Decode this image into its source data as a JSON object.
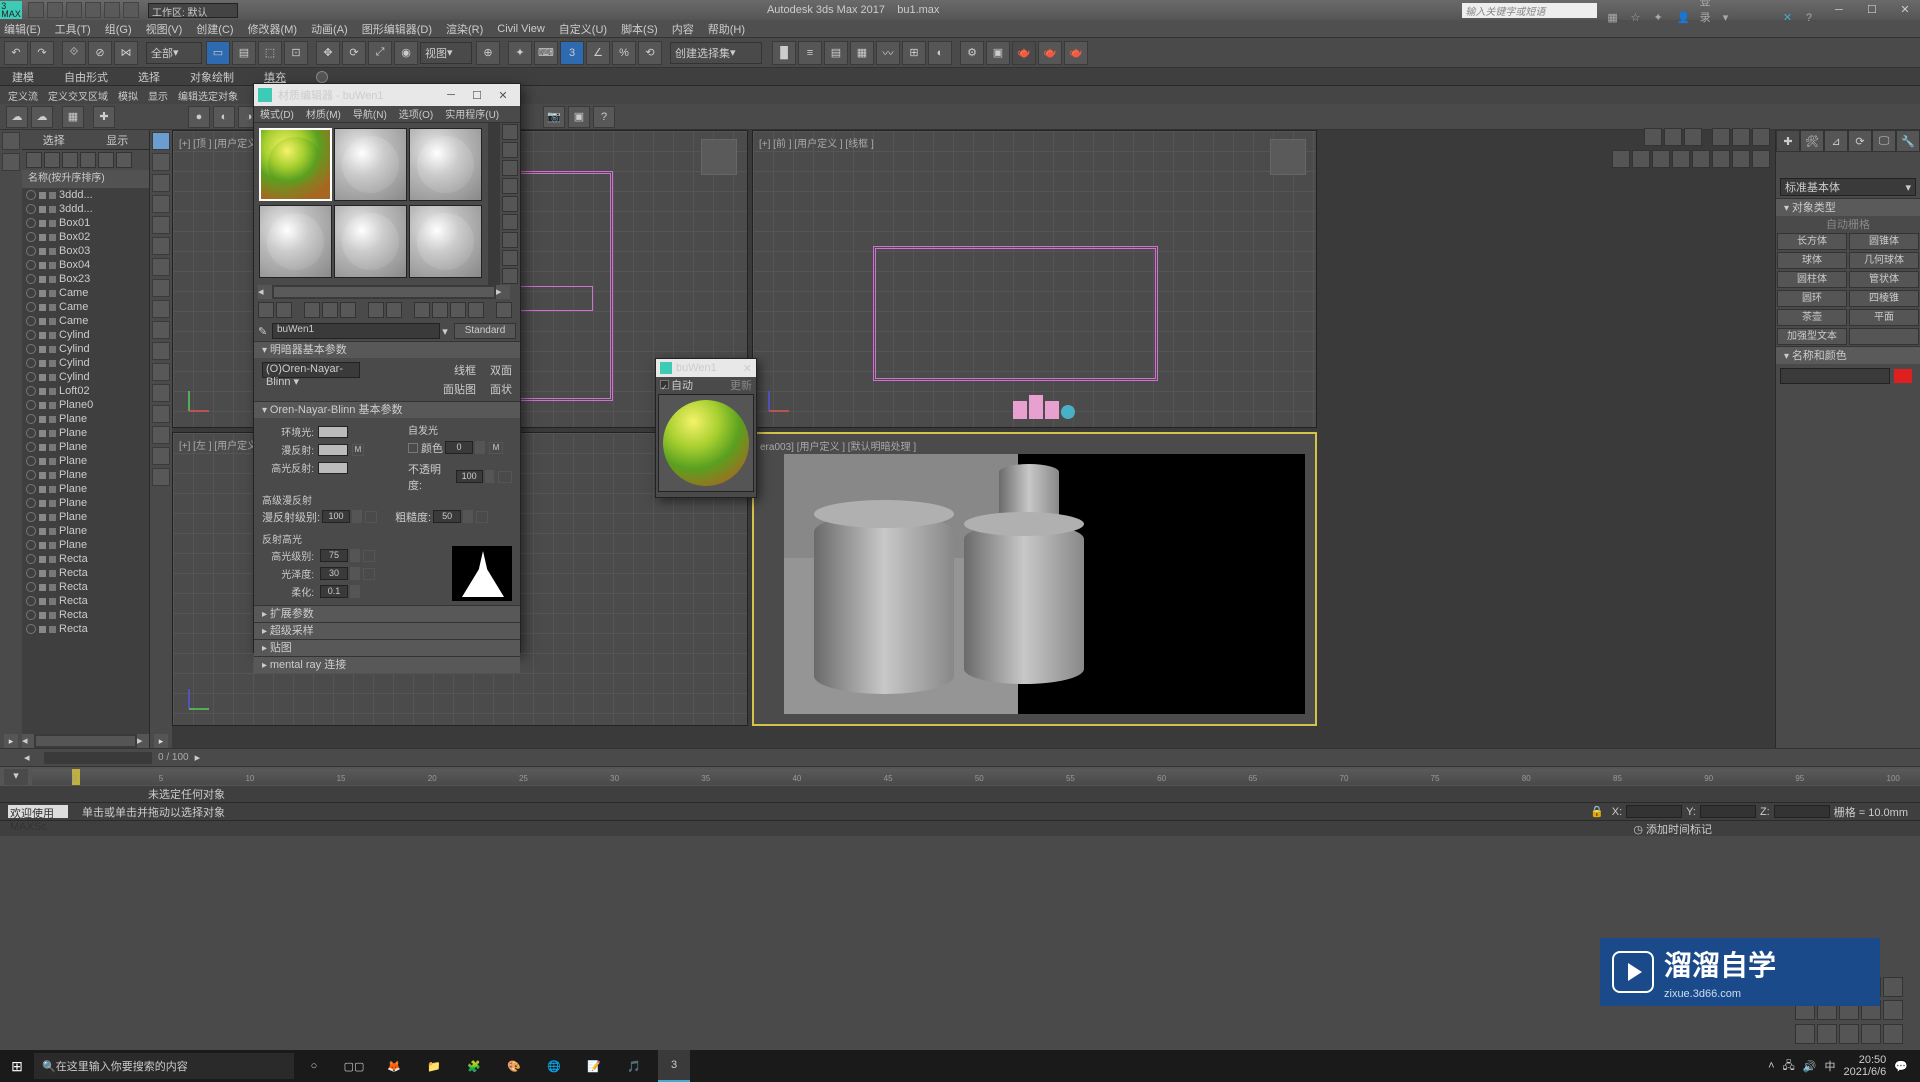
{
  "app": {
    "title": "Autodesk 3ds Max 2017",
    "file": "bu1.max",
    "workspace_label": "工作区: 默认",
    "search_placeholder": "输入关键字或短语",
    "login": "登录"
  },
  "menu": [
    "编辑(E)",
    "工具(T)",
    "组(G)",
    "视图(V)",
    "创建(C)",
    "修改器(M)",
    "动画(A)",
    "图形编辑器(D)",
    "渲染(R)",
    "Civil View",
    "自定义(U)",
    "脚本(S)",
    "内容",
    "帮助(H)"
  ],
  "toolbar": {
    "combo_all": "全部",
    "combo_view": "视图",
    "combo_sel": "创建选择集"
  },
  "tabs": [
    "建模",
    "自由形式",
    "选择",
    "对象绘制",
    "填充"
  ],
  "subtabs": [
    "定义流",
    "定义交叉区域",
    "模拟",
    "显示",
    "编辑选定对象"
  ],
  "outliner": {
    "select": "选择",
    "display": "显示",
    "name_header": "名称(按升序排序)",
    "items": [
      "3ddd...",
      "3ddd...",
      "Box01",
      "Box02",
      "Box03",
      "Box04",
      "Box23",
      "Came",
      "Came",
      "Came",
      "Cylind",
      "Cylind",
      "Cylind",
      "Cylind",
      "Loft02",
      "Plane0",
      "Plane",
      "Plane",
      "Plane",
      "Plane",
      "Plane",
      "Plane",
      "Plane",
      "Plane",
      "Plane",
      "Plane",
      "Recta",
      "Recta",
      "Recta",
      "Recta",
      "Recta",
      "Recta"
    ]
  },
  "viewports": {
    "top": "[+] [顶 ] [用户定义 ] [线框 ]",
    "front": "[+] [前 ] [用户定义 ] [线框 ]",
    "left": "[+] [左 ] [用户定义 ] [线框 ]",
    "cam": "era003] [用户定义 ] [默认明暗处理 ]"
  },
  "mateditor": {
    "title": "材质编辑器 - buWen1",
    "menu": [
      "模式(D)",
      "材质(M)",
      "导航(N)",
      "选项(O)",
      "实用程序(U)"
    ],
    "name": "buWen1",
    "type": "Standard",
    "roll_basic": "明暗器基本参数",
    "shader": "(O)Oren-Nayar-Blinn",
    "wire": "线框",
    "twosided": "双面",
    "facemap": "面贴图",
    "faceted": "面状",
    "roll_onb": "Oren-Nayar-Blinn 基本参数",
    "ambient": "环境光:",
    "diffuse": "漫反射:",
    "specular": "高光反射:",
    "selfillum": "自发光",
    "color": "颜色",
    "selfillum_val": "0",
    "M": "M",
    "opacity": "不透明度:",
    "opacity_val": "100",
    "adv_diffuse": "高级漫反射",
    "diffuse_lvl": "漫反射级别:",
    "diffuse_lvl_val": "100",
    "roughness": "粗糙度:",
    "roughness_val": "50",
    "spec_hdr": "反射高光",
    "spec_lvl": "高光级别:",
    "spec_lvl_val": "75",
    "gloss": "光泽度:",
    "gloss_val": "30",
    "soften": "柔化:",
    "soften_val": "0.1",
    "roll_ext": "扩展参数",
    "roll_ss": "超级采样",
    "roll_maps": "贴图",
    "roll_mr": "mental ray 连接"
  },
  "matprev": {
    "title": "buWen1",
    "auto": "自动",
    "update": "更新"
  },
  "cmdpanel": {
    "combo": "标准基本体",
    "roll_objtype": "对象类型",
    "autogrid": "自动栅格",
    "btns": [
      [
        "长方体",
        "圆锥体"
      ],
      [
        "球体",
        "几何球体"
      ],
      [
        "圆柱体",
        "管状体"
      ],
      [
        "圆环",
        "四棱锥"
      ],
      [
        "茶壶",
        "平面"
      ],
      [
        "加强型文本",
        ""
      ]
    ],
    "roll_name": "名称和颜色"
  },
  "trackbar": {
    "frames": "0 / 100"
  },
  "timeline": {
    "ticks": [
      "0",
      "5",
      "10",
      "15",
      "20",
      "25",
      "30",
      "35",
      "40",
      "45",
      "50",
      "55",
      "60",
      "65",
      "70",
      "75",
      "80",
      "85",
      "90",
      "95",
      "100"
    ]
  },
  "status": {
    "line1": "未选定任何对象",
    "welcome": "欢迎使用 MAXSc",
    "line2": "单击或单击并拖动以选择对象",
    "X": "X:",
    "Y": "Y:",
    "Z": "Z:",
    "grid": "栅格 = 10.0mm",
    "addtime": "添加时间标记"
  },
  "watermark": {
    "text": "溜溜自学",
    "url": "zixue.3d66.com"
  },
  "taskbar": {
    "search": "在这里输入你要搜索的内容",
    "time": "20:50",
    "date": "2021/6/6"
  }
}
